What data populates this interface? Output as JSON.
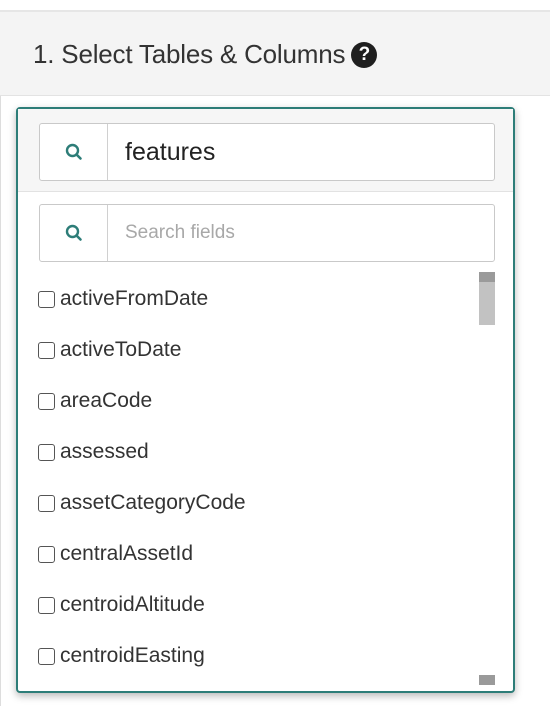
{
  "panel": {
    "title": "1. Select Tables & Columns",
    "help_icon": "question-circle-icon"
  },
  "table_search": {
    "icon": "search-icon",
    "value": "features"
  },
  "field_search": {
    "icon": "search-icon",
    "placeholder": "Search fields"
  },
  "fields": [
    {
      "label": "activeFromDate",
      "checked": false
    },
    {
      "label": "activeToDate",
      "checked": false
    },
    {
      "label": "areaCode",
      "checked": false
    },
    {
      "label": "assessed",
      "checked": false
    },
    {
      "label": "assetCategoryCode",
      "checked": false
    },
    {
      "label": "centralAssetId",
      "checked": false
    },
    {
      "label": "centroidAltitude",
      "checked": false
    },
    {
      "label": "centroidEasting",
      "checked": false
    }
  ],
  "colors": {
    "accent": "#2d7d78",
    "search_icon": "#2d7d78"
  }
}
